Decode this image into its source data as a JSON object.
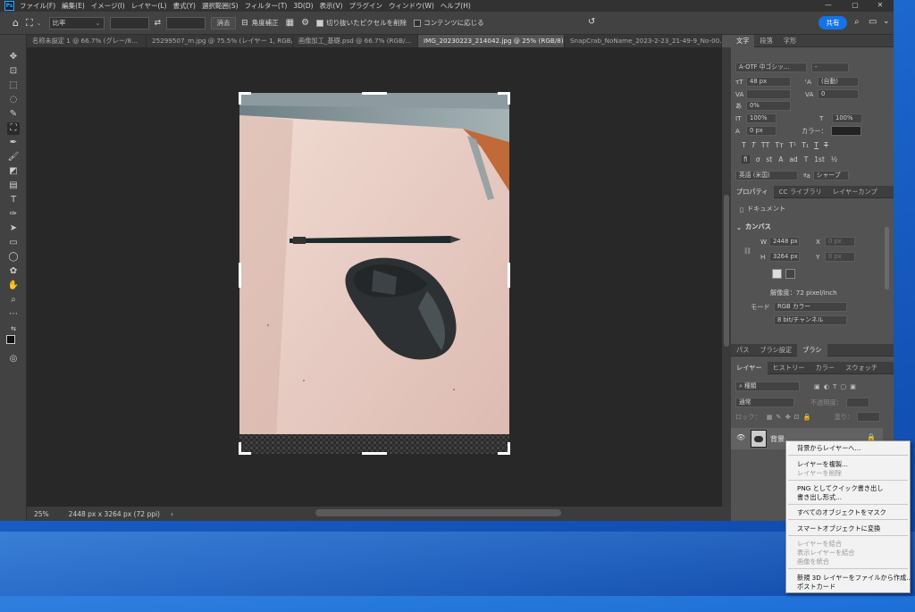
{
  "app": {
    "logo": "Ps"
  },
  "menu": [
    "ファイル(F)",
    "編集(E)",
    "イメージ(I)",
    "レイヤー(L)",
    "書式(Y)",
    "選択範囲(S)",
    "フィルター(T)",
    "3D(D)",
    "表示(V)",
    "プラグイン",
    "ウィンドウ(W)",
    "ヘルプ(H)"
  ],
  "options": {
    "ratio": "比率",
    "clear": "消去",
    "straighten": "角度補正",
    "delete_cropped": "切り抜いたピクセルを削除",
    "content_aware": "コンテンツに応じる",
    "share": "共有"
  },
  "tabs": [
    {
      "label": "名称未設定 1 @ 66.7% (グレー/8...",
      "active": false
    },
    {
      "label": "25299507_m.jpg @ 75.5% (レイヤー 1, RGB/...",
      "active": false
    },
    {
      "label": "画像加工_基礎.psd @ 66.7% (RGB/...",
      "active": false
    },
    {
      "label": "IMG_20230223_214042.jpg @ 25% (RGB/8) *",
      "active": true
    },
    {
      "label": "SnapCrab_NoName_2023-2-23_21-49-9_No-00.p...",
      "active": false
    }
  ],
  "status": {
    "zoom": "25%",
    "doc_size": "2448 px x 3264 px (72 ppi)",
    "arrow": "›"
  },
  "type_panel": {
    "tabs": [
      "文字",
      "段落",
      "字形"
    ],
    "font_family": "A-OTF 中ゴシッ...",
    "font_style": "-",
    "size": "48 px",
    "leading": "(自動)",
    "tracking": "0",
    "kerning_pct": "0%",
    "vscale": "100%",
    "hscale": "100%",
    "baseline": "0 px",
    "color_label": "カラー：",
    "glyph_row1": [
      "T",
      "T",
      "TT",
      "Tт",
      "T¹",
      "T₁",
      "T",
      "T"
    ],
    "glyph_row2": [
      "fi",
      "ơ",
      "st",
      "A",
      "ad",
      "T",
      "1st",
      "½"
    ],
    "language": "英語 (米国)",
    "aa_label": "ªa",
    "antialias": "シャープ"
  },
  "props_panel": {
    "tabs": [
      "プロパティ",
      "CC ライブラリ",
      "レイヤーカンプ"
    ],
    "doc_label": "ドキュメント",
    "section": "カンバス",
    "w_label": "W",
    "w": "2448 px",
    "x_label": "X",
    "x": "0 px",
    "h_label": "H",
    "h": "3264 px",
    "y_label": "Y",
    "y": "0 px",
    "resolution": "解像度：72 pixel/inch",
    "mode_label": "モード",
    "mode": "RGB カラー",
    "depth": "8 bit/チャンネル"
  },
  "brush_panel": {
    "tabs": [
      "パス",
      "ブラシ設定",
      "ブラシ"
    ]
  },
  "layers_panel": {
    "tabs": [
      "レイヤー",
      "ヒストリー",
      "カラー",
      "スウォッチ"
    ],
    "kind": "種類",
    "blend": "通常",
    "opacity_label": "不透明度：",
    "lock_label": "ロック：",
    "fill_label": "塗り：",
    "layer_name": "背景"
  },
  "context_menu": [
    {
      "label": "背景からレイヤーへ...",
      "disabled": false
    },
    {
      "label": "レイヤーを複製...",
      "disabled": false
    },
    {
      "label": "レイヤーを削除",
      "disabled": true
    },
    {
      "label": "PNG としてクイック書き出し",
      "disabled": false
    },
    {
      "label": "書き出し形式...",
      "disabled": false
    },
    {
      "label": "すべてのオブジェクトをマスク",
      "disabled": false
    },
    {
      "label": "スマートオブジェクトに変換",
      "disabled": false
    },
    {
      "label": "レイヤーを結合",
      "disabled": true
    },
    {
      "label": "表示レイヤーを結合",
      "disabled": true
    },
    {
      "label": "画像を統合",
      "disabled": true
    },
    {
      "label": "新規 3D レイヤーをファイルから作成...",
      "disabled": false
    },
    {
      "label": "ポストカード",
      "disabled": false
    }
  ]
}
